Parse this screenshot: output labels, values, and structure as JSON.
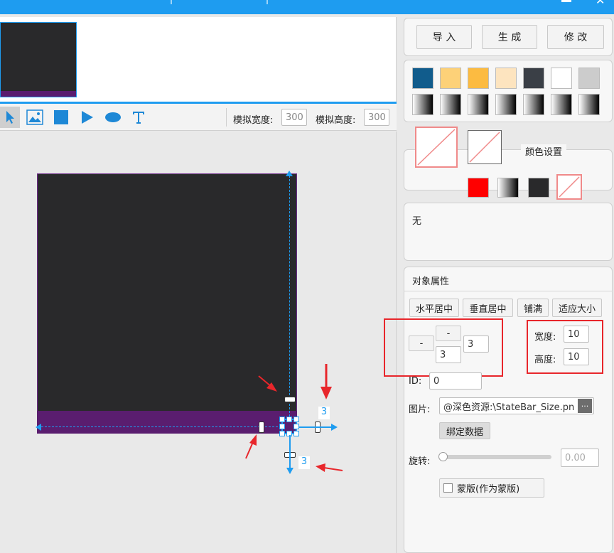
{
  "header": {
    "color": "#1e9cf0"
  },
  "toolbar": {
    "mock_width_label": "模拟宽度:",
    "mock_width_value": "300",
    "mock_height_label": "模拟高度:",
    "mock_height_value": "300",
    "tools": [
      "pointer-icon",
      "image-icon",
      "rectangle-icon",
      "triangle-icon",
      "ellipse-icon",
      "text-icon"
    ]
  },
  "canvas": {
    "measure_right": "3",
    "measure_bottom": "3",
    "colors": {
      "dark": "#29292b",
      "purple": "#5a1d6f",
      "guide": "#1e9cf0",
      "annotation": "#e8262b"
    }
  },
  "actions": {
    "import": "导 入",
    "generate": "生 成",
    "modify": "修 改"
  },
  "swatches": {
    "row1": [
      "#115c8c",
      "#fdd178",
      "#fcbb41",
      "#fde4bf",
      "#3a3f46",
      "#ffffff",
      "#cccccc"
    ]
  },
  "color_settings": {
    "title": "颜色设置",
    "swatches": [
      "#ff0000",
      "gradient",
      "#29292b",
      "none"
    ]
  },
  "resource_panel": {
    "text": "无"
  },
  "properties": {
    "title": "对象属性",
    "h_center": "水平居中",
    "v_center": "垂直居中",
    "fill": "铺满",
    "fit": "适应大小",
    "dash": "-",
    "margin_right": "3",
    "margin_bottom": "3",
    "width_label": "宽度:",
    "width_value": "10",
    "height_label": "高度:",
    "height_value": "10",
    "id_label": "ID:",
    "id_value": "0",
    "image_label": "图片:",
    "image_value": "@深色资源:\\StateBar_Size.pn",
    "image_more": "...",
    "bind_data": "绑定数据",
    "rotate_label": "旋转:",
    "rotate_value": "0.00",
    "mask_label": "蒙版(作为蒙版)"
  }
}
